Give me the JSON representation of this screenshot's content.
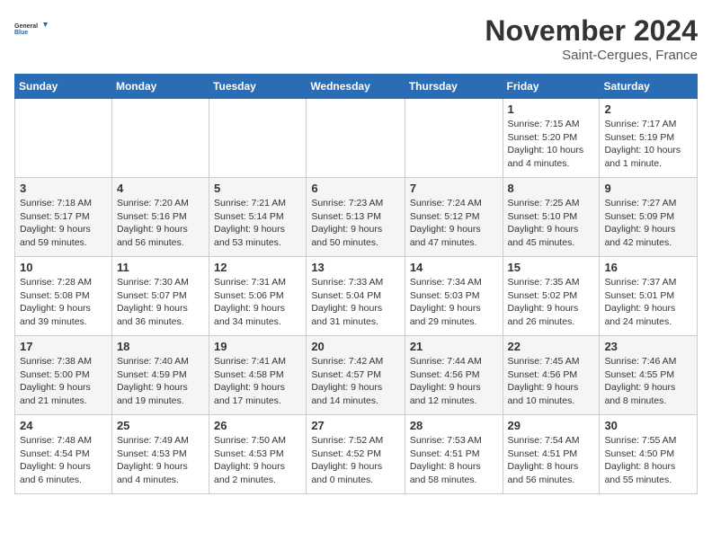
{
  "header": {
    "logo_line1": "General",
    "logo_line2": "Blue",
    "month_title": "November 2024",
    "subtitle": "Saint-Cergues, France"
  },
  "weekdays": [
    "Sunday",
    "Monday",
    "Tuesday",
    "Wednesday",
    "Thursday",
    "Friday",
    "Saturday"
  ],
  "weeks": [
    [
      {
        "day": "",
        "info": ""
      },
      {
        "day": "",
        "info": ""
      },
      {
        "day": "",
        "info": ""
      },
      {
        "day": "",
        "info": ""
      },
      {
        "day": "",
        "info": ""
      },
      {
        "day": "1",
        "info": "Sunrise: 7:15 AM\nSunset: 5:20 PM\nDaylight: 10 hours\nand 4 minutes."
      },
      {
        "day": "2",
        "info": "Sunrise: 7:17 AM\nSunset: 5:19 PM\nDaylight: 10 hours\nand 1 minute."
      }
    ],
    [
      {
        "day": "3",
        "info": "Sunrise: 7:18 AM\nSunset: 5:17 PM\nDaylight: 9 hours\nand 59 minutes."
      },
      {
        "day": "4",
        "info": "Sunrise: 7:20 AM\nSunset: 5:16 PM\nDaylight: 9 hours\nand 56 minutes."
      },
      {
        "day": "5",
        "info": "Sunrise: 7:21 AM\nSunset: 5:14 PM\nDaylight: 9 hours\nand 53 minutes."
      },
      {
        "day": "6",
        "info": "Sunrise: 7:23 AM\nSunset: 5:13 PM\nDaylight: 9 hours\nand 50 minutes."
      },
      {
        "day": "7",
        "info": "Sunrise: 7:24 AM\nSunset: 5:12 PM\nDaylight: 9 hours\nand 47 minutes."
      },
      {
        "day": "8",
        "info": "Sunrise: 7:25 AM\nSunset: 5:10 PM\nDaylight: 9 hours\nand 45 minutes."
      },
      {
        "day": "9",
        "info": "Sunrise: 7:27 AM\nSunset: 5:09 PM\nDaylight: 9 hours\nand 42 minutes."
      }
    ],
    [
      {
        "day": "10",
        "info": "Sunrise: 7:28 AM\nSunset: 5:08 PM\nDaylight: 9 hours\nand 39 minutes."
      },
      {
        "day": "11",
        "info": "Sunrise: 7:30 AM\nSunset: 5:07 PM\nDaylight: 9 hours\nand 36 minutes."
      },
      {
        "day": "12",
        "info": "Sunrise: 7:31 AM\nSunset: 5:06 PM\nDaylight: 9 hours\nand 34 minutes."
      },
      {
        "day": "13",
        "info": "Sunrise: 7:33 AM\nSunset: 5:04 PM\nDaylight: 9 hours\nand 31 minutes."
      },
      {
        "day": "14",
        "info": "Sunrise: 7:34 AM\nSunset: 5:03 PM\nDaylight: 9 hours\nand 29 minutes."
      },
      {
        "day": "15",
        "info": "Sunrise: 7:35 AM\nSunset: 5:02 PM\nDaylight: 9 hours\nand 26 minutes."
      },
      {
        "day": "16",
        "info": "Sunrise: 7:37 AM\nSunset: 5:01 PM\nDaylight: 9 hours\nand 24 minutes."
      }
    ],
    [
      {
        "day": "17",
        "info": "Sunrise: 7:38 AM\nSunset: 5:00 PM\nDaylight: 9 hours\nand 21 minutes."
      },
      {
        "day": "18",
        "info": "Sunrise: 7:40 AM\nSunset: 4:59 PM\nDaylight: 9 hours\nand 19 minutes."
      },
      {
        "day": "19",
        "info": "Sunrise: 7:41 AM\nSunset: 4:58 PM\nDaylight: 9 hours\nand 17 minutes."
      },
      {
        "day": "20",
        "info": "Sunrise: 7:42 AM\nSunset: 4:57 PM\nDaylight: 9 hours\nand 14 minutes."
      },
      {
        "day": "21",
        "info": "Sunrise: 7:44 AM\nSunset: 4:56 PM\nDaylight: 9 hours\nand 12 minutes."
      },
      {
        "day": "22",
        "info": "Sunrise: 7:45 AM\nSunset: 4:56 PM\nDaylight: 9 hours\nand 10 minutes."
      },
      {
        "day": "23",
        "info": "Sunrise: 7:46 AM\nSunset: 4:55 PM\nDaylight: 9 hours\nand 8 minutes."
      }
    ],
    [
      {
        "day": "24",
        "info": "Sunrise: 7:48 AM\nSunset: 4:54 PM\nDaylight: 9 hours\nand 6 minutes."
      },
      {
        "day": "25",
        "info": "Sunrise: 7:49 AM\nSunset: 4:53 PM\nDaylight: 9 hours\nand 4 minutes."
      },
      {
        "day": "26",
        "info": "Sunrise: 7:50 AM\nSunset: 4:53 PM\nDaylight: 9 hours\nand 2 minutes."
      },
      {
        "day": "27",
        "info": "Sunrise: 7:52 AM\nSunset: 4:52 PM\nDaylight: 9 hours\nand 0 minutes."
      },
      {
        "day": "28",
        "info": "Sunrise: 7:53 AM\nSunset: 4:51 PM\nDaylight: 8 hours\nand 58 minutes."
      },
      {
        "day": "29",
        "info": "Sunrise: 7:54 AM\nSunset: 4:51 PM\nDaylight: 8 hours\nand 56 minutes."
      },
      {
        "day": "30",
        "info": "Sunrise: 7:55 AM\nSunset: 4:50 PM\nDaylight: 8 hours\nand 55 minutes."
      }
    ]
  ]
}
